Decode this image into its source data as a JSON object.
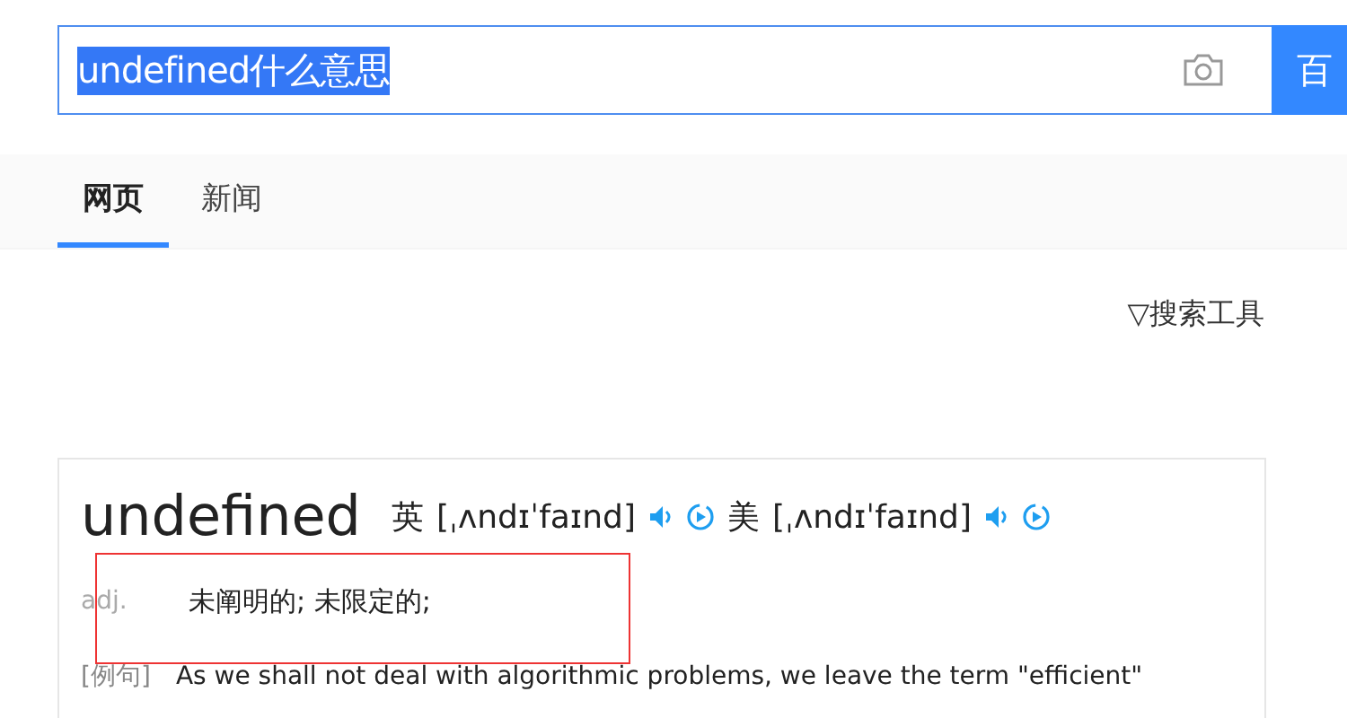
{
  "search": {
    "value": "undefined什么意思",
    "text_selected": true,
    "button_label": "百"
  },
  "tabs": [
    {
      "label": "网页",
      "selected": true
    },
    {
      "label": "新闻",
      "selected": false
    }
  ],
  "search_tools": {
    "icon": "▽",
    "label": "搜索工具"
  },
  "dictionary": {
    "word": "undefined",
    "pronunciations": [
      {
        "region": "英",
        "phonetic": "[ˌʌndɪˈfaɪnd]"
      },
      {
        "region": "美",
        "phonetic": "[ˌʌndɪˈfaɪnd]"
      }
    ],
    "pos": "adj.",
    "definition": "未阐明的; 未限定的;",
    "highlighted": true,
    "example_label": "[例句]",
    "example": "As we shall not deal with algorithmic problems, we leave the term \"efficient\""
  }
}
